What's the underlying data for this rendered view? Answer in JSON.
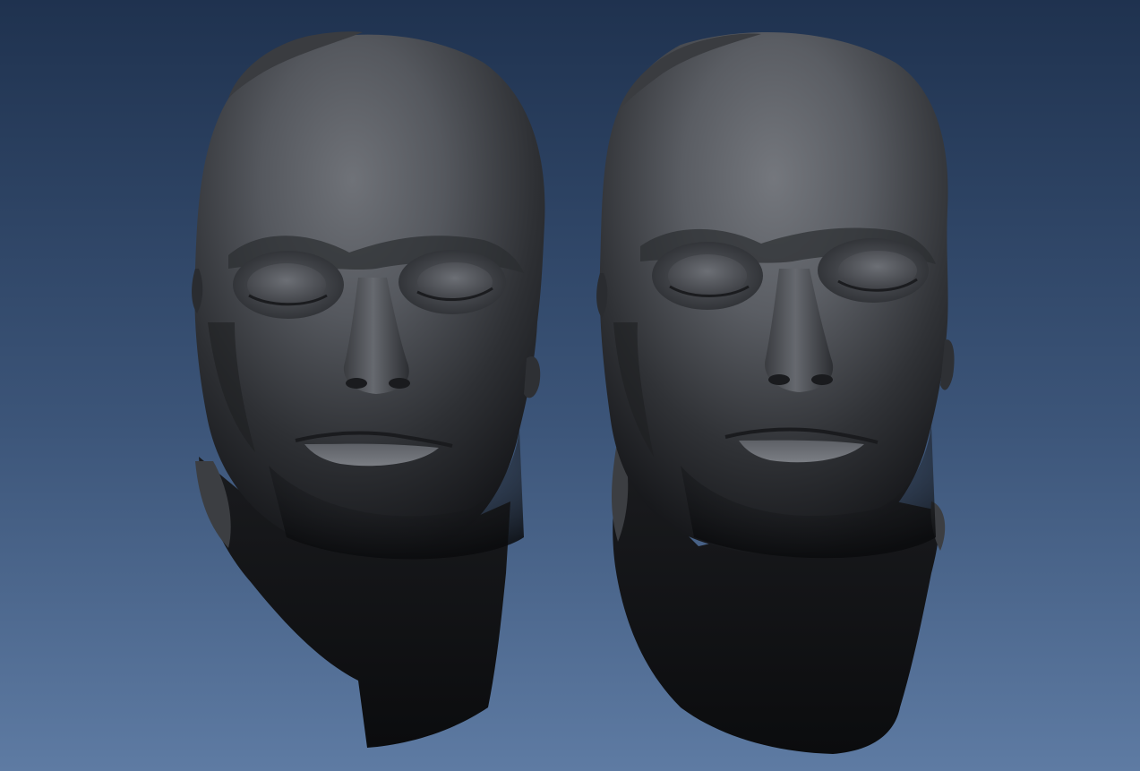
{
  "viewer": {
    "background_top": "#1f324f",
    "background_bottom": "#5e7ba3",
    "mesh_color": "#5a5d63",
    "mesh_shadow": "#0c0d10",
    "models": [
      {
        "name": "death-mask-left"
      },
      {
        "name": "death-mask-right"
      }
    ]
  }
}
